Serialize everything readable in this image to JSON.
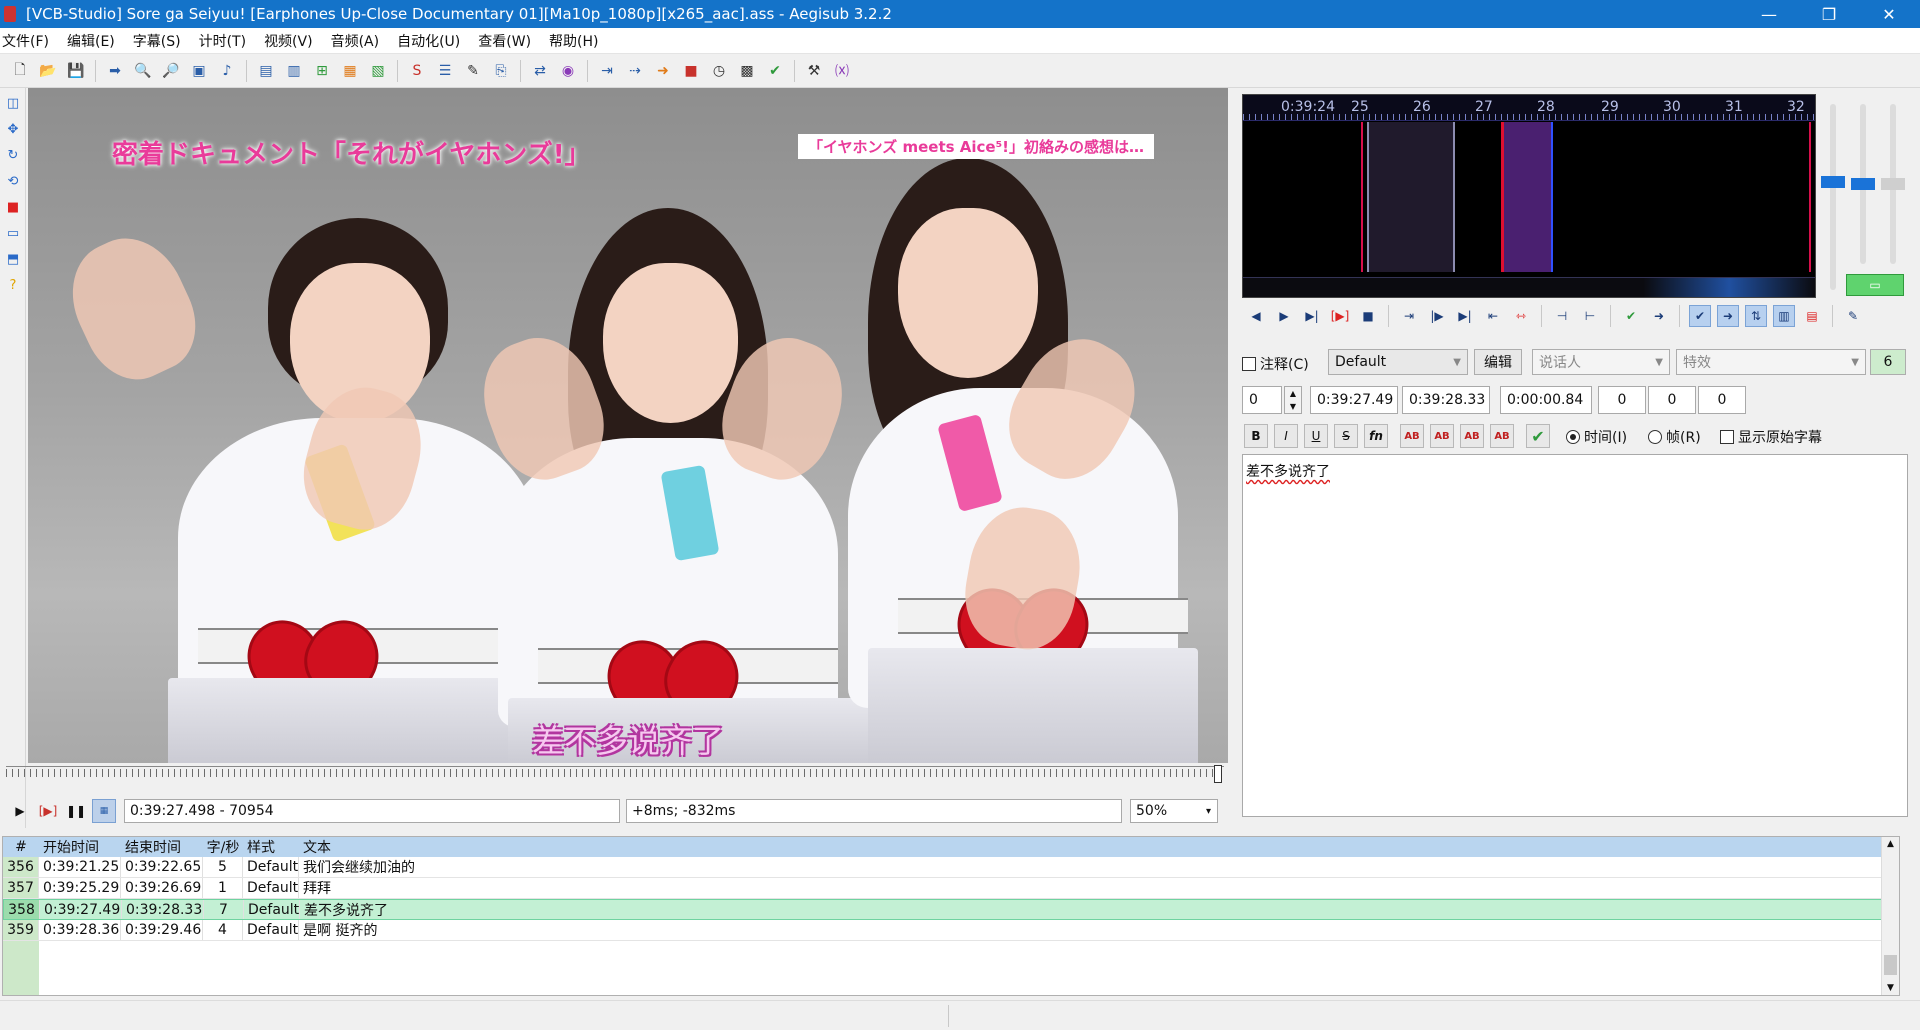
{
  "window": {
    "title": "[VCB-Studio] Sore ga Seiyuu! [Earphones Up-Close Documentary 01][Ma10p_1080p][x265_aac].ass - Aegisub 3.2.2",
    "minimize": "—",
    "maximize": "❐",
    "close": "✕"
  },
  "menu": [
    "文件(F)",
    "编辑(E)",
    "字幕(S)",
    "计时(T)",
    "视频(V)",
    "音频(A)",
    "自动化(U)",
    "查看(W)",
    "帮助(H)"
  ],
  "video": {
    "overlay_left": "密着ドキュメント「それがイヤホンズ!」",
    "overlay_right": "「イヤホンズ meets Aice⁵!」初絡みの感想は…",
    "subtitle": "差不多说齐了",
    "time_display": "0:39:27.498 - 70954",
    "delta_display": "+8ms; -832ms",
    "zoom": "50%"
  },
  "audio": {
    "ruler_labels": [
      "0:39:24",
      "25",
      "26",
      "27",
      "28",
      "29",
      "30",
      "31",
      "32"
    ]
  },
  "edit": {
    "comment_label": "注释(C)",
    "style": "Default",
    "edit_button": "编辑",
    "actor_placeholder": "说话人",
    "effect_placeholder": "特效",
    "char_count": "6",
    "layer": "0",
    "start": "0:39:27.49",
    "end": "0:39:28.33",
    "duration": "0:00:00.84",
    "margin_l": "0",
    "margin_r": "0",
    "margin_v": "0",
    "time_radio": "时间(I)",
    "frame_radio": "帧(R)",
    "show_original": "显示原始字幕",
    "text": "差不多说齐了"
  },
  "grid": {
    "headers": [
      "#",
      "开始时间",
      "结束时间",
      "字/秒",
      "样式",
      "文本"
    ],
    "rows": [
      {
        "num": "356",
        "start": "0:39:21.25",
        "end": "0:39:22.65",
        "cps": "5",
        "style": "Default",
        "text": "我们会继续加油的"
      },
      {
        "num": "357",
        "start": "0:39:25.29",
        "end": "0:39:26.69",
        "cps": "1",
        "style": "Default",
        "text": "拜拜"
      },
      {
        "num": "358",
        "start": "0:39:27.49",
        "end": "0:39:28.33",
        "cps": "7",
        "style": "Default",
        "text": "差不多说齐了"
      },
      {
        "num": "359",
        "start": "0:39:28.36",
        "end": "0:39:29.46",
        "cps": "4",
        "style": "Default",
        "text": "是啊 挺齐的"
      }
    ],
    "selected_row": 2
  }
}
